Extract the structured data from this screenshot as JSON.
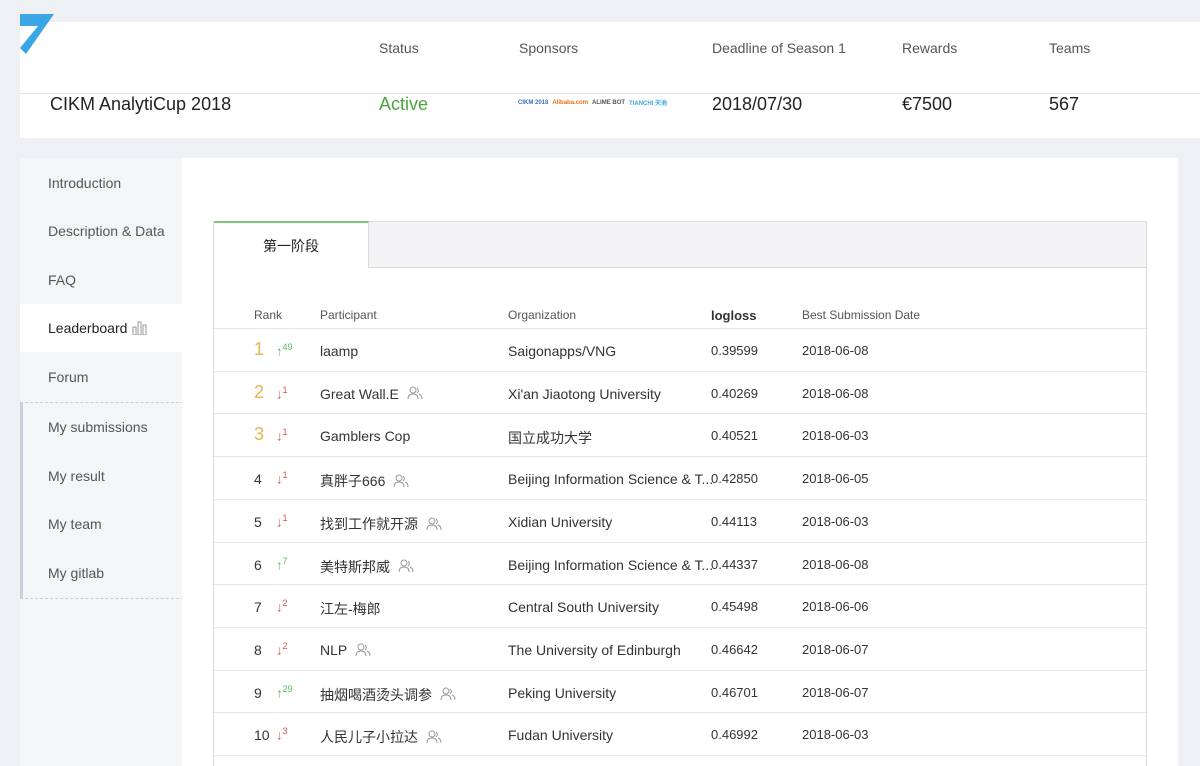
{
  "competition": {
    "headers": [
      "Status",
      "Sponsors",
      "Deadline of Season 1",
      "Rewards",
      "Teams"
    ],
    "name": "CIKM AnalytiCup 2018",
    "status": "Active",
    "sponsors": [
      "CIKM 2018",
      "Alibaba.com",
      "ALIME BOT",
      "TIANCHI 天池"
    ],
    "deadline": "2018/07/30",
    "rewards": "€7500",
    "teams": "567"
  },
  "sidebar": {
    "items": [
      {
        "label": "Introduction",
        "active": false
      },
      {
        "label": "Description & Data",
        "active": false
      },
      {
        "label": "FAQ",
        "active": false
      },
      {
        "label": "Leaderboard",
        "active": true
      },
      {
        "label": "Forum",
        "active": false
      }
    ],
    "my_items": [
      {
        "label": "My submissions"
      },
      {
        "label": "My result"
      },
      {
        "label": "My team"
      },
      {
        "label": "My gitlab"
      }
    ]
  },
  "leaderboard": {
    "tab": "第一阶段",
    "columns": {
      "rank": "Rank",
      "participant": "Participant",
      "organization": "Organization",
      "score": "logloss",
      "date": "Best Submission Date"
    },
    "rows": [
      {
        "rank": "1",
        "dir": "up",
        "change": "49",
        "participant": "laamp",
        "team": false,
        "organization": "Saigonapps/VNG",
        "score": "0.39599",
        "date": "2018-06-08"
      },
      {
        "rank": "2",
        "dir": "down",
        "change": "1",
        "participant": "Great Wall.E",
        "team": true,
        "organization": "Xi'an Jiaotong University",
        "score": "0.40269",
        "date": "2018-06-08"
      },
      {
        "rank": "3",
        "dir": "down",
        "change": "1",
        "participant": "Gamblers Cop",
        "team": false,
        "organization": "国立成功大学",
        "score": "0.40521",
        "date": "2018-06-03"
      },
      {
        "rank": "4",
        "dir": "down",
        "change": "1",
        "participant": "真胖子666",
        "team": true,
        "organization": "Beijing Information Science & T...",
        "score": "0.42850",
        "date": "2018-06-05"
      },
      {
        "rank": "5",
        "dir": "down",
        "change": "1",
        "participant": "找到工作就开源",
        "team": true,
        "organization": "Xidian University",
        "score": "0.44113",
        "date": "2018-06-03"
      },
      {
        "rank": "6",
        "dir": "up",
        "change": "7",
        "participant": "美特斯邦威",
        "team": true,
        "organization": "Beijing Information Science & T...",
        "score": "0.44337",
        "date": "2018-06-08"
      },
      {
        "rank": "7",
        "dir": "down",
        "change": "2",
        "participant": "江左-梅郎",
        "team": false,
        "organization": "Central South University",
        "score": "0.45498",
        "date": "2018-06-06"
      },
      {
        "rank": "8",
        "dir": "down",
        "change": "2",
        "participant": "NLP",
        "team": true,
        "organization": "The University of Edinburgh",
        "score": "0.46642",
        "date": "2018-06-07"
      },
      {
        "rank": "9",
        "dir": "up",
        "change": "29",
        "participant": "抽烟喝酒烫头调参",
        "team": true,
        "organization": "Peking University",
        "score": "0.46701",
        "date": "2018-06-07"
      },
      {
        "rank": "10",
        "dir": "down",
        "change": "3",
        "participant": "人民儿子小拉达",
        "team": true,
        "organization": "Fudan University",
        "score": "0.46992",
        "date": "2018-06-03"
      }
    ]
  },
  "colors": {
    "accent_green": "#4aa63c",
    "rank_gold": "#e8b54a",
    "up": "#5cb85c",
    "down": "#d9534f",
    "logo_blue": "#3aa6e6"
  }
}
